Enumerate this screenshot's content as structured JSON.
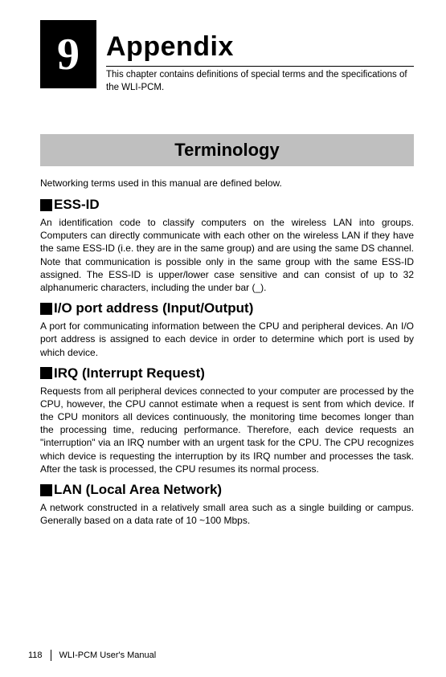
{
  "chapter": {
    "number": "9",
    "title": "Appendix",
    "description": "This chapter contains definitions of special terms and the specifications of the WLI-PCM."
  },
  "section": {
    "banner": "Terminology",
    "intro": "Networking terms used in this manual are defined below."
  },
  "terms": [
    {
      "heading": "ESS-ID",
      "body": "An identification code to classify computers on the wireless LAN into groups. Computers can directly communicate with each other on the wireless LAN if they have the same ESS-ID (i.e. they are in the same group) and are using the same DS channel.  Note that communication is possible only in the same group with the same ESS-ID assigned.  The ESS-ID is upper/lower case sensitive and can consist of up to 32 alphanumeric characters, including the under bar (_)."
    },
    {
      "heading": "I/O port address (Input/Output)",
      "body": "A port for communicating information between the CPU and peripheral devices. An I/O port address is assigned to each device in order to determine which port is used by which device."
    },
    {
      "heading": "IRQ (Interrupt Request)",
      "body": "Requests from all peripheral devices connected to your computer are processed by the CPU, however, the CPU cannot estimate when a request is sent from which device.  If the CPU monitors all devices continuously, the monitoring time becomes longer than the processing time, reducing performance.  Therefore, each device requests an \"interruption\" via an IRQ number with an urgent task for the CPU.  The CPU recognizes which device is requesting the interruption by its IRQ number and processes the task.  After the task is processed, the CPU resumes its normal process."
    },
    {
      "heading": "LAN (Local Area Network)",
      "body": "A network constructed in a relatively small area such as a single building or campus.  Generally based on a data rate of 10 ~100 Mbps."
    }
  ],
  "footer": {
    "page": "118",
    "manual": "WLI-PCM User's Manual"
  }
}
